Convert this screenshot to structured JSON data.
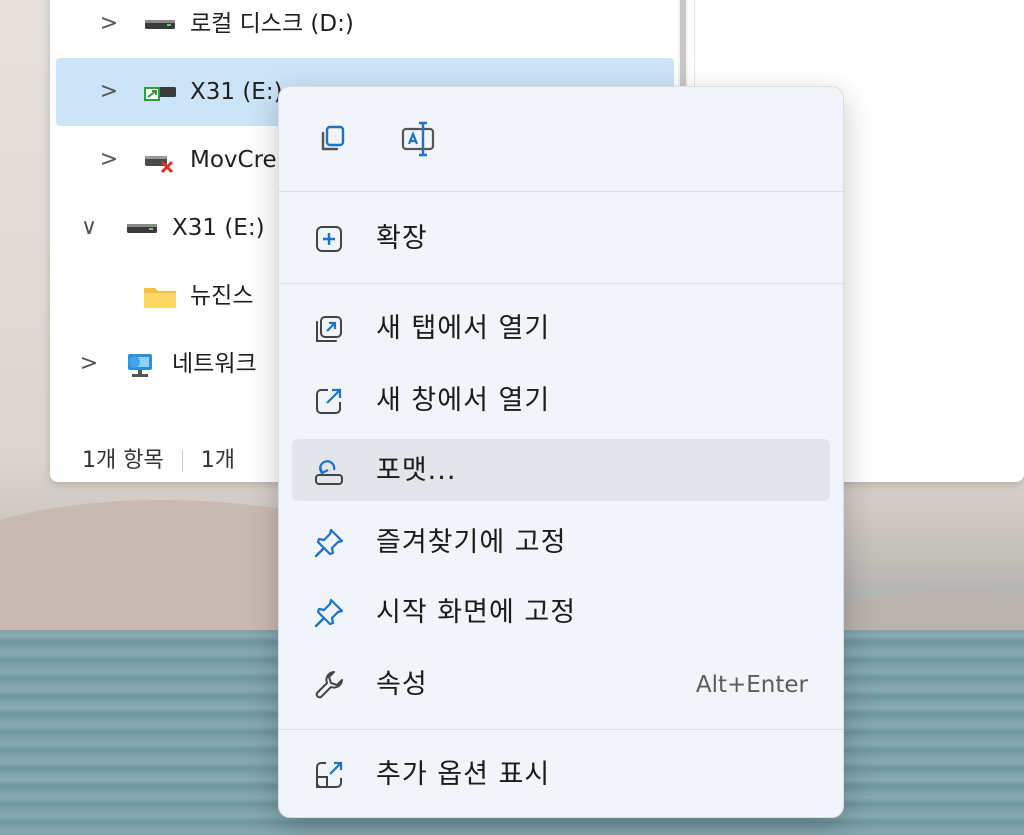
{
  "explorer": {
    "tree": [
      {
        "label": "로컬 디스크 (D:)",
        "expander": ">",
        "icon": "drive-icon"
      },
      {
        "label": "X31 (E:)",
        "expander": ">",
        "icon": "usb-drive-icon",
        "selected": true
      },
      {
        "label": "MovCre",
        "expander": ">",
        "icon": "disconnected-drive-icon"
      },
      {
        "label": "X31 (E:)",
        "expander": "∨",
        "icon": "drive-icon"
      },
      {
        "label": "뉴진스",
        "expander": "",
        "icon": "folder-icon"
      },
      {
        "label": "네트워크",
        "expander": ">",
        "icon": "network-icon"
      }
    ],
    "status": {
      "items_count": "1개 항목",
      "selected_count": "1개"
    }
  },
  "context_menu": {
    "quick_actions": [
      {
        "name": "copy-icon"
      },
      {
        "name": "rename-icon"
      }
    ],
    "items": [
      {
        "label": "확장",
        "icon": "expand-icon"
      },
      {
        "label": "새 탭에서 열기",
        "icon": "open-new-tab-icon"
      },
      {
        "label": "새 창에서 열기",
        "icon": "open-new-window-icon"
      },
      {
        "label": "포맷...",
        "icon": "format-drive-icon",
        "hovered": true
      },
      {
        "label": "즐겨찾기에 고정",
        "icon": "pin-icon"
      },
      {
        "label": "시작 화면에 고정",
        "icon": "pin-icon"
      },
      {
        "label": "속성",
        "icon": "wrench-icon",
        "accelerator": "Alt+Enter"
      },
      {
        "label": "추가 옵션 표시",
        "icon": "more-options-icon"
      }
    ]
  },
  "colors": {
    "selection": "#cce4f7",
    "accent": "#1a73c9",
    "menu_bg": "#f1f4f8"
  }
}
